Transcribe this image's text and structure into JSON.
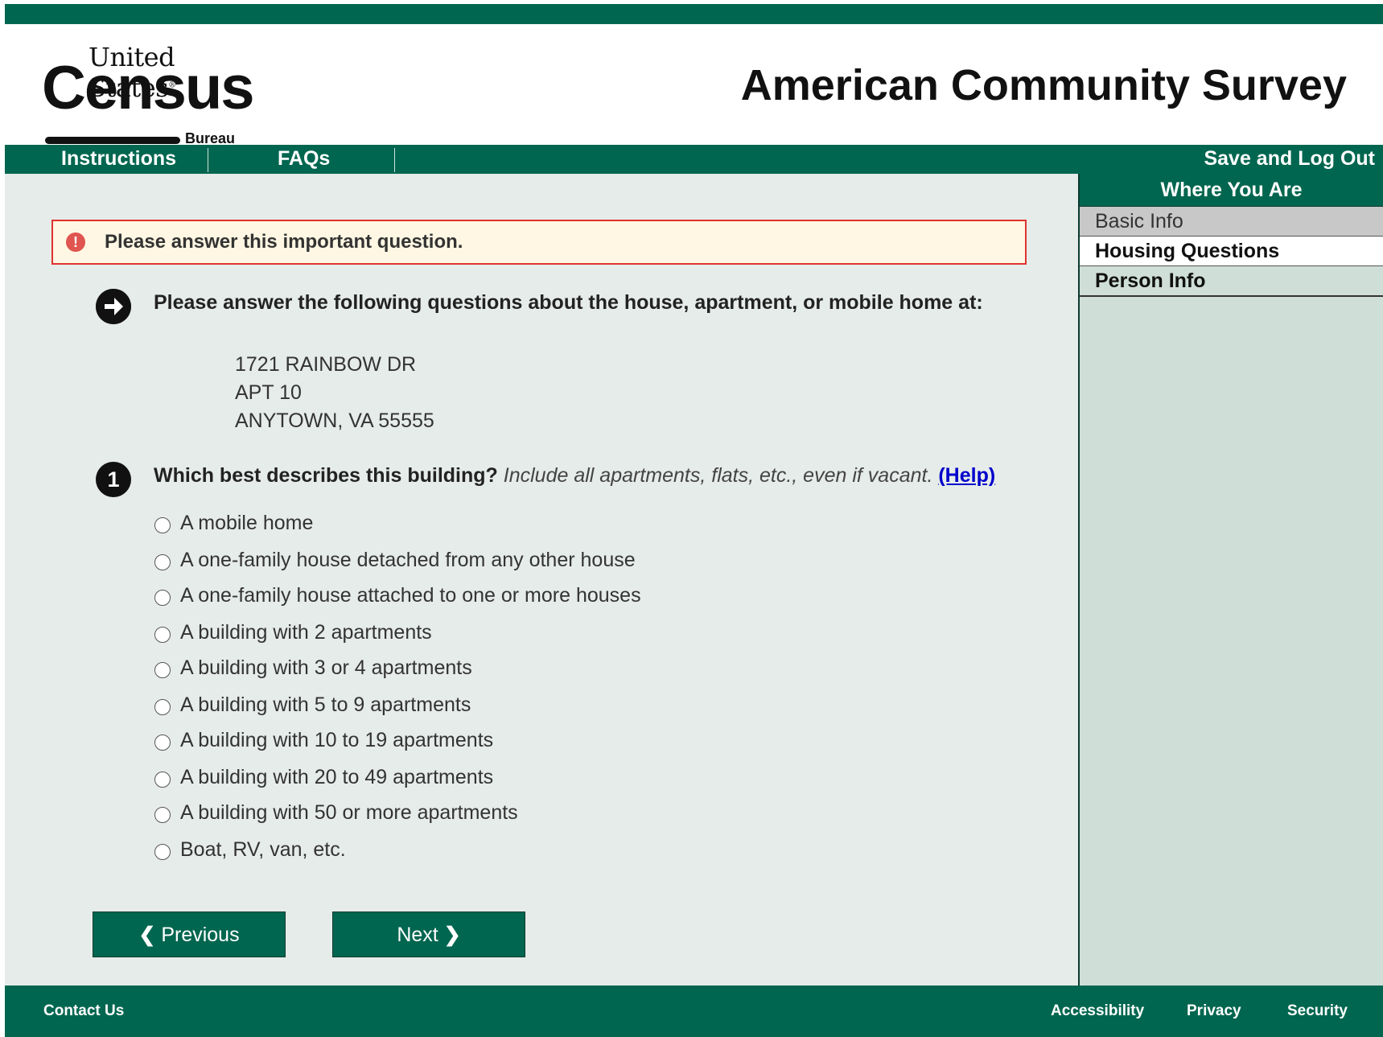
{
  "header": {
    "logo": {
      "top": "United States",
      "mark": "Census",
      "bottom": "Bureau"
    },
    "title": "American Community Survey"
  },
  "nav": {
    "instructions": "Instructions",
    "faqs": "FAQs",
    "save_logout": "Save and Log Out"
  },
  "sidebar": {
    "heading": "Where You Are",
    "items": [
      {
        "label": "Basic Info",
        "state": "done"
      },
      {
        "label": "Housing Questions",
        "state": "current"
      },
      {
        "label": "Person Info",
        "state": "upcoming"
      }
    ]
  },
  "alert": {
    "icon": "error-icon",
    "text": "Please answer this important question."
  },
  "intro": {
    "icon": "arrow-right-circle-icon",
    "text": "Please answer the following questions about the house, apartment, or mobile home at:"
  },
  "address": [
    "1721 RAINBOW DR",
    "APT 10",
    "ANYTOWN, VA 55555"
  ],
  "question": {
    "number": "1",
    "text": "Which best describes this building?",
    "note": "Include all apartments, flats, etc., even if vacant.",
    "help": "(Help)",
    "options": [
      "A mobile home",
      "A one-family house detached from any other house",
      "A one-family house attached to one or more houses",
      "A building with 2 apartments",
      "A building with 3 or 4 apartments",
      "A building with 5 to 9 apartments",
      "A building with 10 to 19 apartments",
      "A building with 20 to 49 apartments",
      "A building with 50 or more apartments",
      "Boat, RV, van, etc."
    ]
  },
  "buttons": {
    "previous": "Previous",
    "next": "Next"
  },
  "footer": {
    "contact": "Contact Us",
    "accessibility": "Accessibility",
    "privacy": "Privacy",
    "security": "Security"
  },
  "colors": {
    "brand_green": "#00664f",
    "alert_border": "#e0322e",
    "alert_bg": "#fff7e3",
    "link_blue": "#0000cc"
  }
}
